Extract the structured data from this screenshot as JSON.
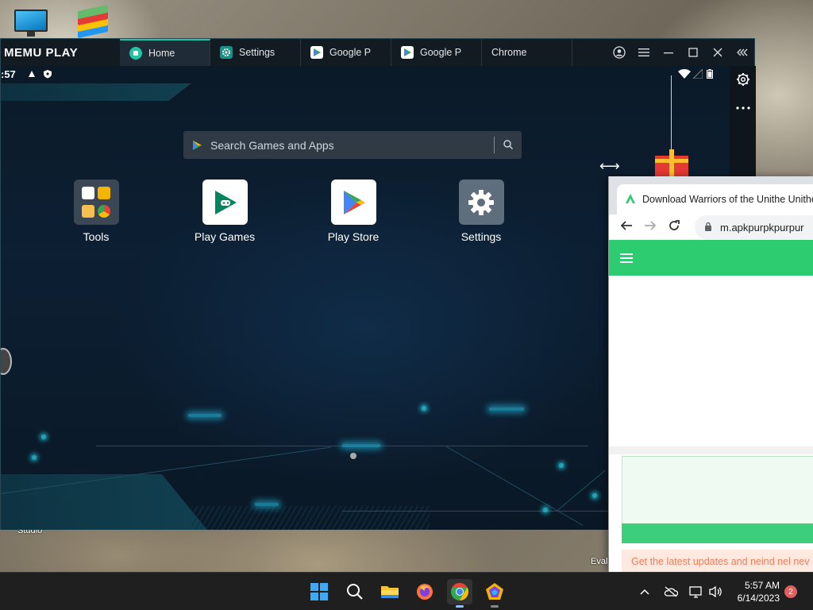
{
  "memu": {
    "logo": "MEMU PLAY",
    "tabs": [
      {
        "label": "Home",
        "icon": "home-icon",
        "active": true
      },
      {
        "label": "Settings",
        "icon": "settings-gear-icon",
        "active": false
      },
      {
        "label": "Google P",
        "icon": "google-play-icon",
        "active": false
      },
      {
        "label": "Google P",
        "icon": "google-play-icon",
        "active": false
      },
      {
        "label": "Chrome",
        "icon": "chrome-icon",
        "active": false
      }
    ],
    "window_controls": [
      "account-icon",
      "menu-icon",
      "minimize-icon",
      "maximize-icon",
      "close-icon",
      "collapse-icon"
    ],
    "side_controls": [
      "settings-gear-icon",
      "more-icon"
    ]
  },
  "android": {
    "status_time": ":57",
    "search_placeholder": "Search Games and Apps",
    "apps": [
      {
        "label": "Tools"
      },
      {
        "label": "Play Games"
      },
      {
        "label": "Play Store"
      },
      {
        "label": "Settings"
      }
    ]
  },
  "chrome": {
    "tab_title": "Download Warriors of the Unithe Unithe Uni",
    "url": "m.apkpurpkpurpur",
    "notice": "Get the latest updates and neind nel nev"
  },
  "desktop": {
    "studio_label": "Studio",
    "eval_label": "Eval"
  },
  "taskbar": {
    "time": "5:57 AM",
    "date": "6/14/2023",
    "notification_count": "2",
    "accent": "#20c5a3"
  }
}
